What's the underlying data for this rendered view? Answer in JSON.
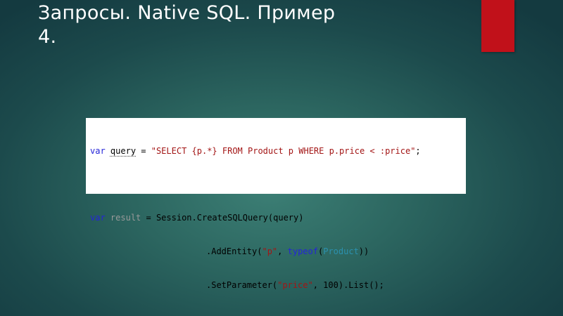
{
  "slide": {
    "title": "Запросы. Native SQL. Пример 4.",
    "accent_color": "#c1111a"
  },
  "code": {
    "line1": {
      "kw_var": "var",
      "space1": " ",
      "ident_query": "query",
      "op_assign": " = ",
      "str_sql": "\"SELECT {p.*} FROM Product p WHERE p.price < :price\"",
      "semicolon": ";"
    },
    "line3": {
      "kw_var": "var",
      "space1": " ",
      "ident_result": "result",
      "rest": " = Session.CreateSQLQuery(query)"
    },
    "line4": {
      "call_start": ".AddEntity(",
      "str_p": "\"p\"",
      "comma": ", ",
      "kw_typeof": "typeof",
      "paren_open": "(",
      "type_product": "Product",
      "paren_close": "))"
    },
    "line5": {
      "call_start": ".SetParameter(",
      "str_price": "\"price\"",
      "rest": ", 100).List();"
    }
  }
}
